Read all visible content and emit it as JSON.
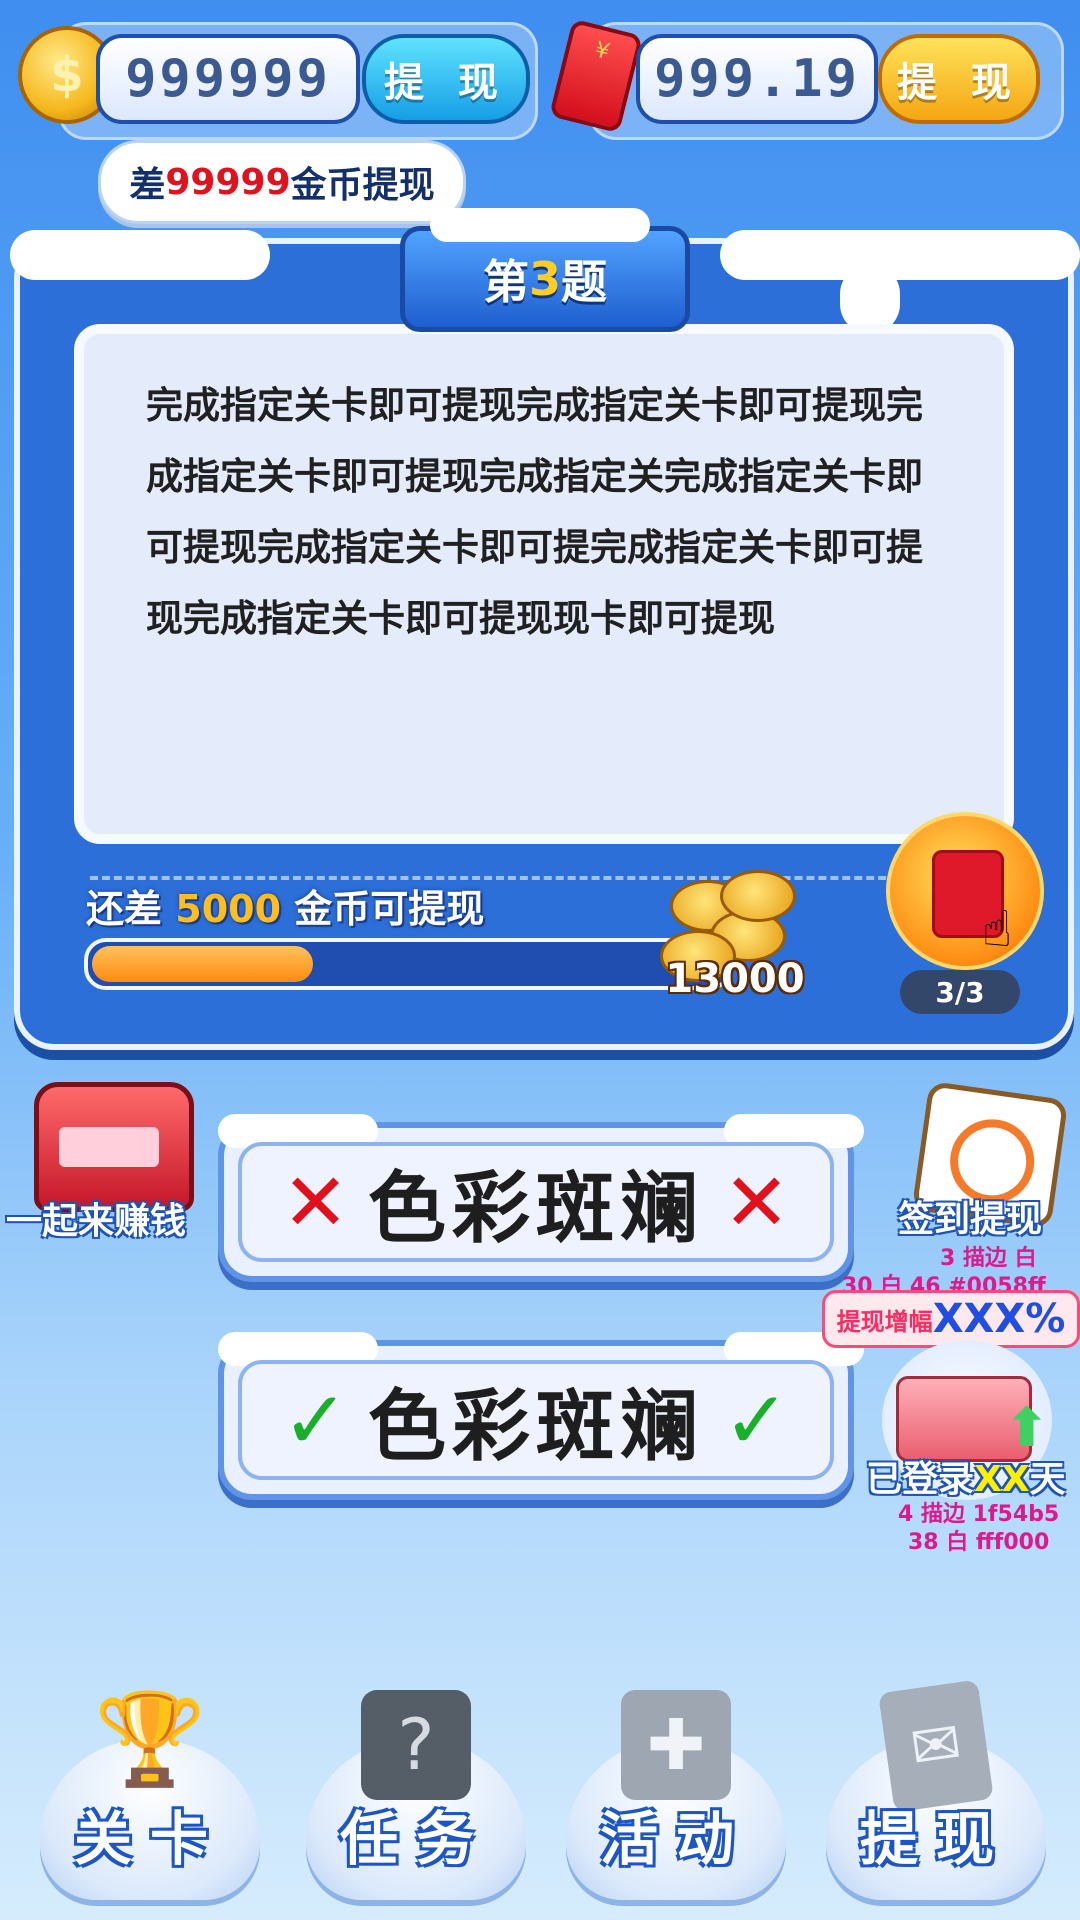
{
  "top_bar": {
    "coins_value": "999999",
    "coins_withdraw_label": "提 现",
    "cash_value": "999.19",
    "cash_withdraw_label": "提 现",
    "cash_envelope_symbol": "¥"
  },
  "coin_gap_tag": {
    "prefix": "差",
    "amount": "99999",
    "suffix": "金币提现"
  },
  "question_card": {
    "title_prefix": "第",
    "title_number": "3",
    "title_suffix": "题",
    "question_text": "完成指定关卡即可提现完成指定关卡即可提现完成指定关卡即可提现完成指定关完成指定关卡即可提现完成指定关卡即可提完成指定关卡即可提现完成指定关卡即可提现现卡即可提现",
    "progress": {
      "prefix": "还差",
      "remaining": "5000",
      "suffix": "金币可提现",
      "fill_fraction": 0.35,
      "target": "13000"
    },
    "red_packet_counter": "3/3"
  },
  "answers": [
    {
      "text": "色彩斑斓",
      "mark": "✕",
      "state": "wrong"
    },
    {
      "text": "色彩斑斓",
      "mark": "✓",
      "state": "correct"
    }
  ],
  "side_left": {
    "earn_together_label": "一起来赚钱"
  },
  "side_right": {
    "checkin_label": "签到提现",
    "checkin_note_1": "3 描边 白",
    "checkin_note_2": "30 白 46 #0058ff",
    "boost_label": "提现增幅",
    "boost_value": "XXX%",
    "logged_prefix": "已登录",
    "logged_days": "XX",
    "logged_suffix": "天",
    "logged_note_1": "4 描边 1f54b5",
    "logged_note_2": "38 白 fff000"
  },
  "bottom_nav": [
    {
      "label": "关卡",
      "icon": "trophy-icon"
    },
    {
      "label": "任务",
      "icon": "question-book-icon"
    },
    {
      "label": "活动",
      "icon": "gift-box-icon"
    },
    {
      "label": "提现",
      "icon": "cash-cards-icon"
    }
  ],
  "colors": {
    "bg_top": "#3f8ef0",
    "card_blue": "#2d6fd8",
    "gold": "#ffcd25",
    "red": "#e0121e",
    "green": "#18b02a",
    "progress_orange": "#ff8a10"
  }
}
